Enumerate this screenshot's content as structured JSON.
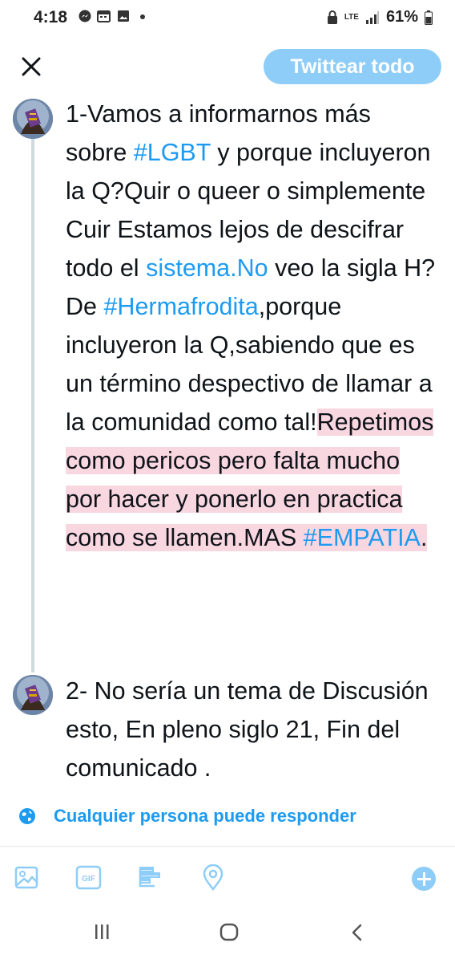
{
  "status_bar": {
    "time": "4:18",
    "network": "LTE",
    "battery": "61%"
  },
  "header": {
    "close_icon": "close-icon",
    "tweet_all_label": "Twittear todo"
  },
  "thread": {
    "tweet1": {
      "s1": "1-Vamos a informarnos más sobre ",
      "tag1": "#LGBT",
      "s2": " y porque incluyeron la Q?Quir o queer o simplemente Cuir Estamos lejos de descifrar todo el ",
      "link1": "sistema.No",
      "s3": " veo la sigla H?De ",
      "tag2": "#Hermafrodita",
      "s4": ",porque incluyeron la Q,sabiendo que es un término despectivo de llamar a la comunidad como tal!",
      "over1": "Repetimos como pericos pero falta mucho por hacer y ponerlo en practica como se llamen.MAS ",
      "tag3": "#EMPATIA",
      "s5": "."
    },
    "tweet2": {
      "text": "2- No sería un tema de Discusión esto, En pleno siglo 21, Fin del comunicado ."
    }
  },
  "reply_setting": {
    "icon": "globe-icon",
    "label": "Cualquier persona puede responder"
  },
  "toolbar": {
    "icons": [
      "image-icon",
      "gif-icon",
      "poll-icon",
      "location-icon",
      "add-icon"
    ],
    "gif_label": "GIF"
  },
  "colors": {
    "accent": "#1d9bf0",
    "accent_disabled": "#8ecdf7",
    "highlight": "#f9d7e1",
    "text": "#0f1419"
  }
}
